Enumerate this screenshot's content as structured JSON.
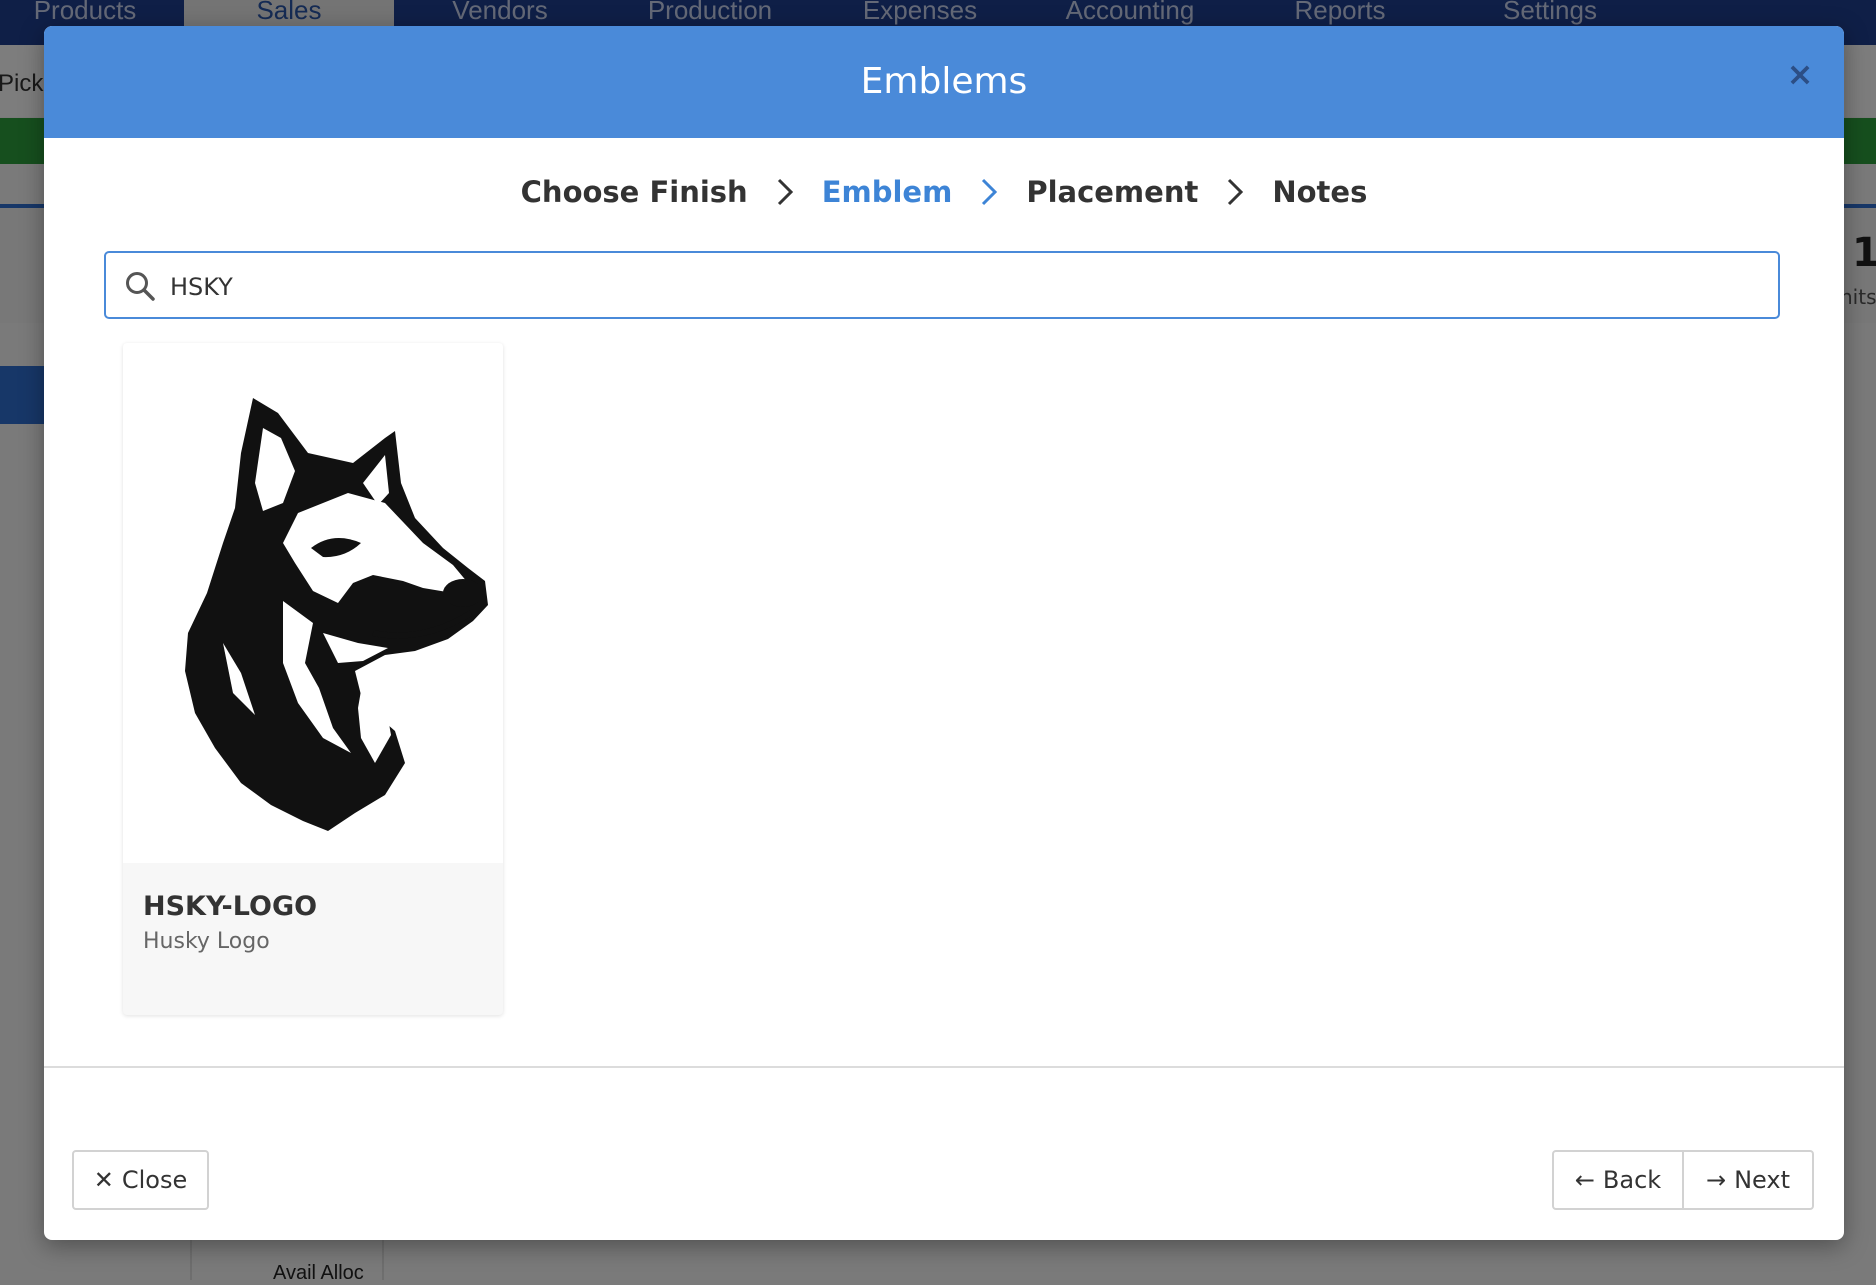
{
  "background": {
    "nav_items": [
      "Products",
      "Sales",
      "Vendors",
      "Production",
      "Expenses",
      "Accounting",
      "Reports",
      "Settings"
    ],
    "active_nav": "Sales",
    "pick_label": "Pick",
    "right_number": "1",
    "right_units": "nits",
    "bottom_text": "Avail Alloc"
  },
  "modal": {
    "title": "Emblems",
    "close_icon": "×",
    "steps": [
      {
        "label": "Choose Finish",
        "active": false
      },
      {
        "label": "Emblem",
        "active": true
      },
      {
        "label": "Placement",
        "active": false
      },
      {
        "label": "Notes",
        "active": false
      }
    ],
    "search": {
      "value": "HSKY",
      "icon": "search-icon"
    },
    "results": [
      {
        "code": "HSKY-LOGO",
        "description": "Husky Logo",
        "image": "husky-logo"
      }
    ],
    "buttons": {
      "close": "Close",
      "close_icon": "✕",
      "back": "Back",
      "back_icon": "←",
      "next": "Next",
      "next_icon": "→"
    }
  },
  "colors": {
    "header_blue": "#4a8ad9",
    "active_step": "#3d84d6",
    "nav_blue": "#1f3f8f"
  }
}
